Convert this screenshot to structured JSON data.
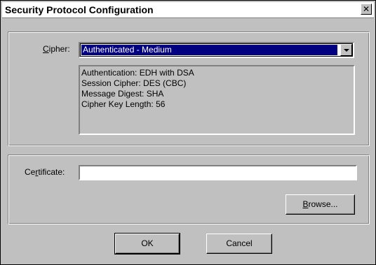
{
  "window": {
    "title": "Security Protocol Configuration",
    "close_glyph": "✕"
  },
  "cipher_section": {
    "label_prefix": "",
    "label_hotkey": "C",
    "label_rest": "ipher:",
    "selected_value": "Authenticated - Medium",
    "details": [
      "Authentication: EDH with DSA",
      "Session Cipher: DES (CBC)",
      "Message Digest: SHA",
      "Cipher Key Length: 56"
    ]
  },
  "certificate_section": {
    "label_prefix": "Ce",
    "label_hotkey": "r",
    "label_rest": "tificate:",
    "value": "",
    "browse_prefix": "",
    "browse_hotkey": "B",
    "browse_rest": "rowse..."
  },
  "buttons": {
    "ok": "OK",
    "cancel": "Cancel"
  }
}
